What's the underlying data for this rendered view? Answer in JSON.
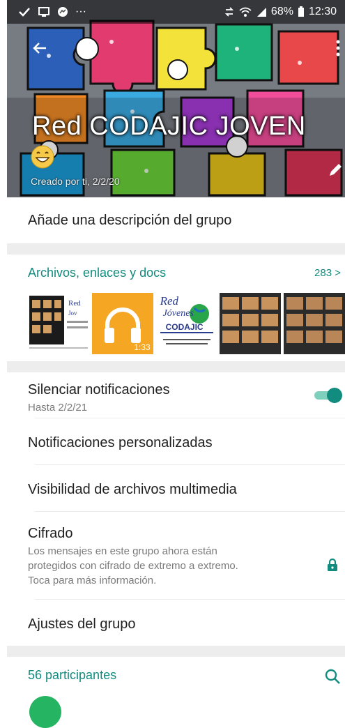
{
  "status_bar": {
    "left_icons": [
      "check-icon",
      "screen-icon",
      "messenger-icon",
      "ellipsis"
    ],
    "ellipsis": "···",
    "battery": "68%",
    "time": "12:30"
  },
  "header": {
    "group_name": "Red CODAJIC JOVEN",
    "emoji": "😄",
    "created": "Creado por ti, 2/2/20"
  },
  "description": {
    "label": "Añade una descripción del grupo"
  },
  "media": {
    "title": "Archivos, enlaces y docs",
    "count": "283 >",
    "audio_duration": "1:33",
    "logo_text_1": "Red",
    "logo_text_2": "Jóvenes",
    "logo_text_3": "CODAJIC"
  },
  "settings": {
    "mute_title": "Silenciar notificaciones",
    "mute_sub": "Hasta 2/2/21",
    "custom_notif": "Notificaciones personalizadas",
    "media_visibility": "Visibilidad de archivos multimedia",
    "encryption_title": "Cifrado",
    "encryption_line1": "Los mensajes en este grupo ahora están",
    "encryption_line2": "protegidos con cifrado de extremo a extremo.",
    "encryption_line3": "Toca para más información.",
    "group_settings": "Ajustes del grupo"
  },
  "participants": {
    "title": "56 participantes"
  },
  "colors": {
    "accent": "#128c7e",
    "toggle_track": "#7fcfbd",
    "audio_tile": "#f5a623",
    "avatar": "#25b562"
  }
}
